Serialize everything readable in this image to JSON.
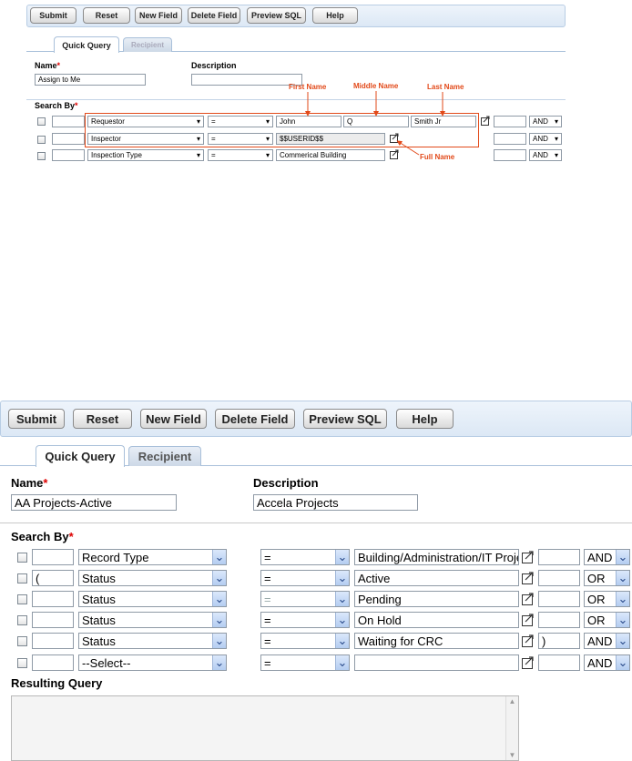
{
  "panel1": {
    "toolbar": [
      "Submit",
      "Reset",
      "New Field",
      "Delete Field",
      "Preview SQL",
      "Help"
    ],
    "tabs": [
      "Quick Query",
      "Recipient"
    ],
    "name_label": "Name",
    "name_required": "*",
    "name_value": "Assign to Me",
    "description_label": "Description",
    "description_value": "",
    "search_by_label": "Search By",
    "search_by_required": "*",
    "rows": [
      {
        "paren_open": "",
        "field": "Requestor",
        "operator": "=",
        "values": [
          "John",
          "Q",
          "Smith Jr"
        ],
        "paren_close": "",
        "logic": "AND"
      },
      {
        "paren_open": "",
        "field": "Inspector",
        "operator": "=",
        "values": [
          "$$USERID$$"
        ],
        "paren_close": "",
        "logic": "AND"
      },
      {
        "paren_open": "",
        "field": "Inspection Type",
        "operator": "=",
        "values": [
          "Commerical Building"
        ],
        "paren_close": "",
        "logic": "AND"
      }
    ],
    "annotations": {
      "first_name": "First Name",
      "middle_name": "Middle Name",
      "last_name": "Last Name",
      "full_name": "Full Name"
    }
  },
  "panel2": {
    "toolbar": [
      "Submit",
      "Reset",
      "New Field",
      "Delete Field",
      "Preview SQL",
      "Help"
    ],
    "tabs": [
      "Quick Query",
      "Recipient"
    ],
    "name_label": "Name",
    "name_required": "*",
    "name_value": "AA Projects-Active",
    "description_label": "Description",
    "description_value": "Accela Projects",
    "search_by_label": "Search By",
    "search_by_required": "*",
    "rows": [
      {
        "paren_open": "",
        "field": "Record Type",
        "operator": "=",
        "operator_disabled": false,
        "value": "Building/Administration/IT Project",
        "paren_close": "",
        "logic": "AND"
      },
      {
        "paren_open": "(",
        "field": "Status",
        "operator": "=",
        "operator_disabled": false,
        "value": "Active",
        "paren_close": "",
        "logic": "OR"
      },
      {
        "paren_open": "",
        "field": "Status",
        "operator": "=",
        "operator_disabled": true,
        "value": "Pending",
        "paren_close": "",
        "logic": "OR"
      },
      {
        "paren_open": "",
        "field": "Status",
        "operator": "=",
        "operator_disabled": false,
        "value": "On Hold",
        "paren_close": "",
        "logic": "OR"
      },
      {
        "paren_open": "",
        "field": "Status",
        "operator": "=",
        "operator_disabled": false,
        "value": "Waiting for CRC",
        "paren_close": ")",
        "logic": "AND"
      },
      {
        "paren_open": "",
        "field": "--Select--",
        "operator": "=",
        "operator_disabled": false,
        "value": "",
        "paren_close": "",
        "logic": "AND"
      }
    ],
    "resulting_query_label": "Resulting Query",
    "resulting_query_value": ""
  },
  "colors": {
    "annotation": "#e24a1a",
    "toolbar_bg": "#dce8f5",
    "tab_border": "#a9c0da",
    "required": "#dd0000"
  },
  "icons": {
    "picker": "picker-popup-icon",
    "dropdown": "chevron-down-icon"
  }
}
